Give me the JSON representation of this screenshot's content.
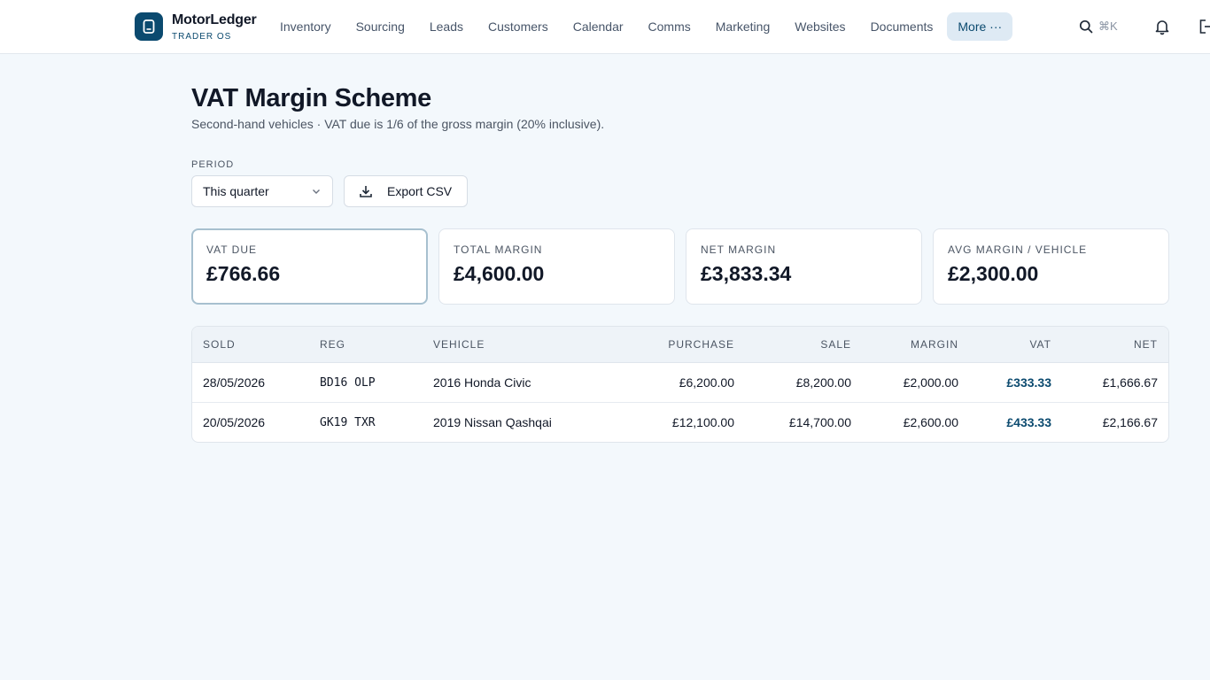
{
  "brand": {
    "name": "MotorLedger",
    "subtitle": "TRADER OS"
  },
  "nav": {
    "items": [
      {
        "label": "Inventory"
      },
      {
        "label": "Sourcing"
      },
      {
        "label": "Leads"
      },
      {
        "label": "Customers"
      },
      {
        "label": "Calendar"
      },
      {
        "label": "Comms"
      },
      {
        "label": "Marketing"
      },
      {
        "label": "Websites"
      },
      {
        "label": "Documents"
      }
    ],
    "more_label": "More ···"
  },
  "search": {
    "shortcut": "⌘K",
    "icon": "search-icon"
  },
  "icons": {
    "bell": "bell-icon",
    "logout": "logout-icon"
  },
  "header": {
    "title": "VAT Margin Scheme",
    "subtitle": "Second-hand vehicles · VAT due is 1/6 of the gross margin (20% inclusive)."
  },
  "controls": {
    "period_label": "PERIOD",
    "period_value": "This quarter",
    "export_label": "Export CSV"
  },
  "stats": [
    {
      "label": "VAT due",
      "value": "£766.66"
    },
    {
      "label": "Total margin",
      "value": "£4,600.00"
    },
    {
      "label": "Net margin",
      "value": "£3,833.34"
    },
    {
      "label": "Avg margin / vehicle",
      "value": "£2,300.00"
    }
  ],
  "table": {
    "columns": [
      "SOLD",
      "REG",
      "VEHICLE",
      "PURCHASE",
      "SALE",
      "MARGIN",
      "VAT",
      "NET"
    ],
    "rows": [
      [
        "28/05/2026",
        "BD16 OLP",
        "2016 Honda Civic",
        "£6,200.00",
        "£8,200.00",
        "£2,000.00",
        "£333.33",
        "£1,666.67"
      ],
      [
        "20/05/2026",
        "GK19 TXR",
        "2019 Nissan Qashqai",
        "£12,100.00",
        "£14,700.00",
        "£2,600.00",
        "£433.33",
        "£2,166.67"
      ]
    ]
  },
  "colors": {
    "accent": "#0b4a6f",
    "background": "#f3f8fc"
  }
}
